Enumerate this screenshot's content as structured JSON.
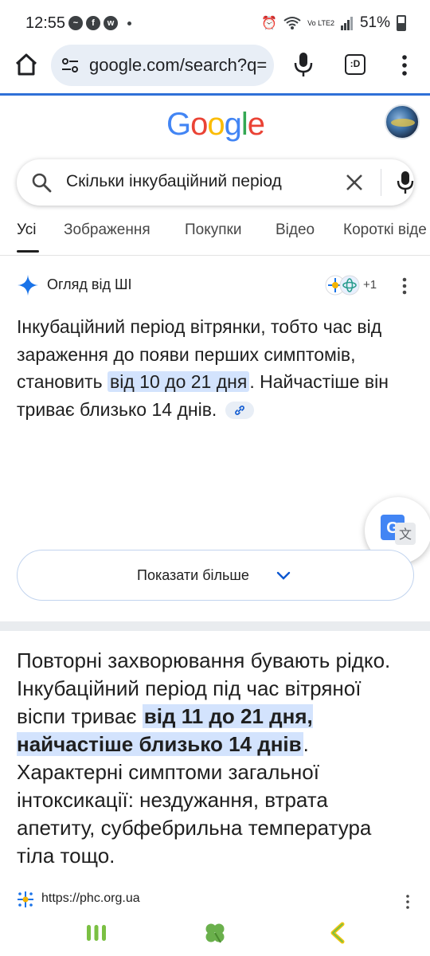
{
  "status_bar": {
    "time": "12:55",
    "battery": "51%",
    "lte": "Vo LTE2",
    "app_icons": [
      "messenger-icon",
      "facebook-icon",
      "whatsapp-icon"
    ]
  },
  "browser": {
    "url": "google.com/search?q=",
    "tabs_label": ":D"
  },
  "google": {
    "logo": "Google",
    "colors": {
      "blue": "#4285F4",
      "red": "#EA4335",
      "yellow": "#FBBC05",
      "green": "#34A853"
    }
  },
  "search": {
    "query": "Скільки інкубаційний період"
  },
  "tabs": [
    {
      "label": "Усі",
      "active": true
    },
    {
      "label": "Зображення"
    },
    {
      "label": "Покупки"
    },
    {
      "label": "Відео"
    },
    {
      "label": "Короткі віде"
    }
  ],
  "ai_overview": {
    "title": "Огляд від ШІ",
    "sources_more": "+1",
    "text_before": "Інкубаційний період вітрянки, тобто час від зараження до появи перших симптомів, становить ",
    "text_highlight": "від 10 до 21 дня",
    "text_after": ". Найчастіше він триває близько 14 днів.",
    "show_more": "Показати більше"
  },
  "snippet": {
    "text_before": "Повторні захворювання бувають рідко. Інкубаційний період під час вітряної віспи триває ",
    "text_highlight": "від 11 до 21 дня, найчастіше близько 14 днів",
    "text_after": ". Характерні симптоми загальної інтоксикації: нездужання, втрата апетиту, субфебрильна температура тіла тощо.",
    "source_url": "https://phc.org.ua"
  },
  "bottom_nav": [
    "recent-apps-icon",
    "home-icon",
    "back-icon"
  ]
}
